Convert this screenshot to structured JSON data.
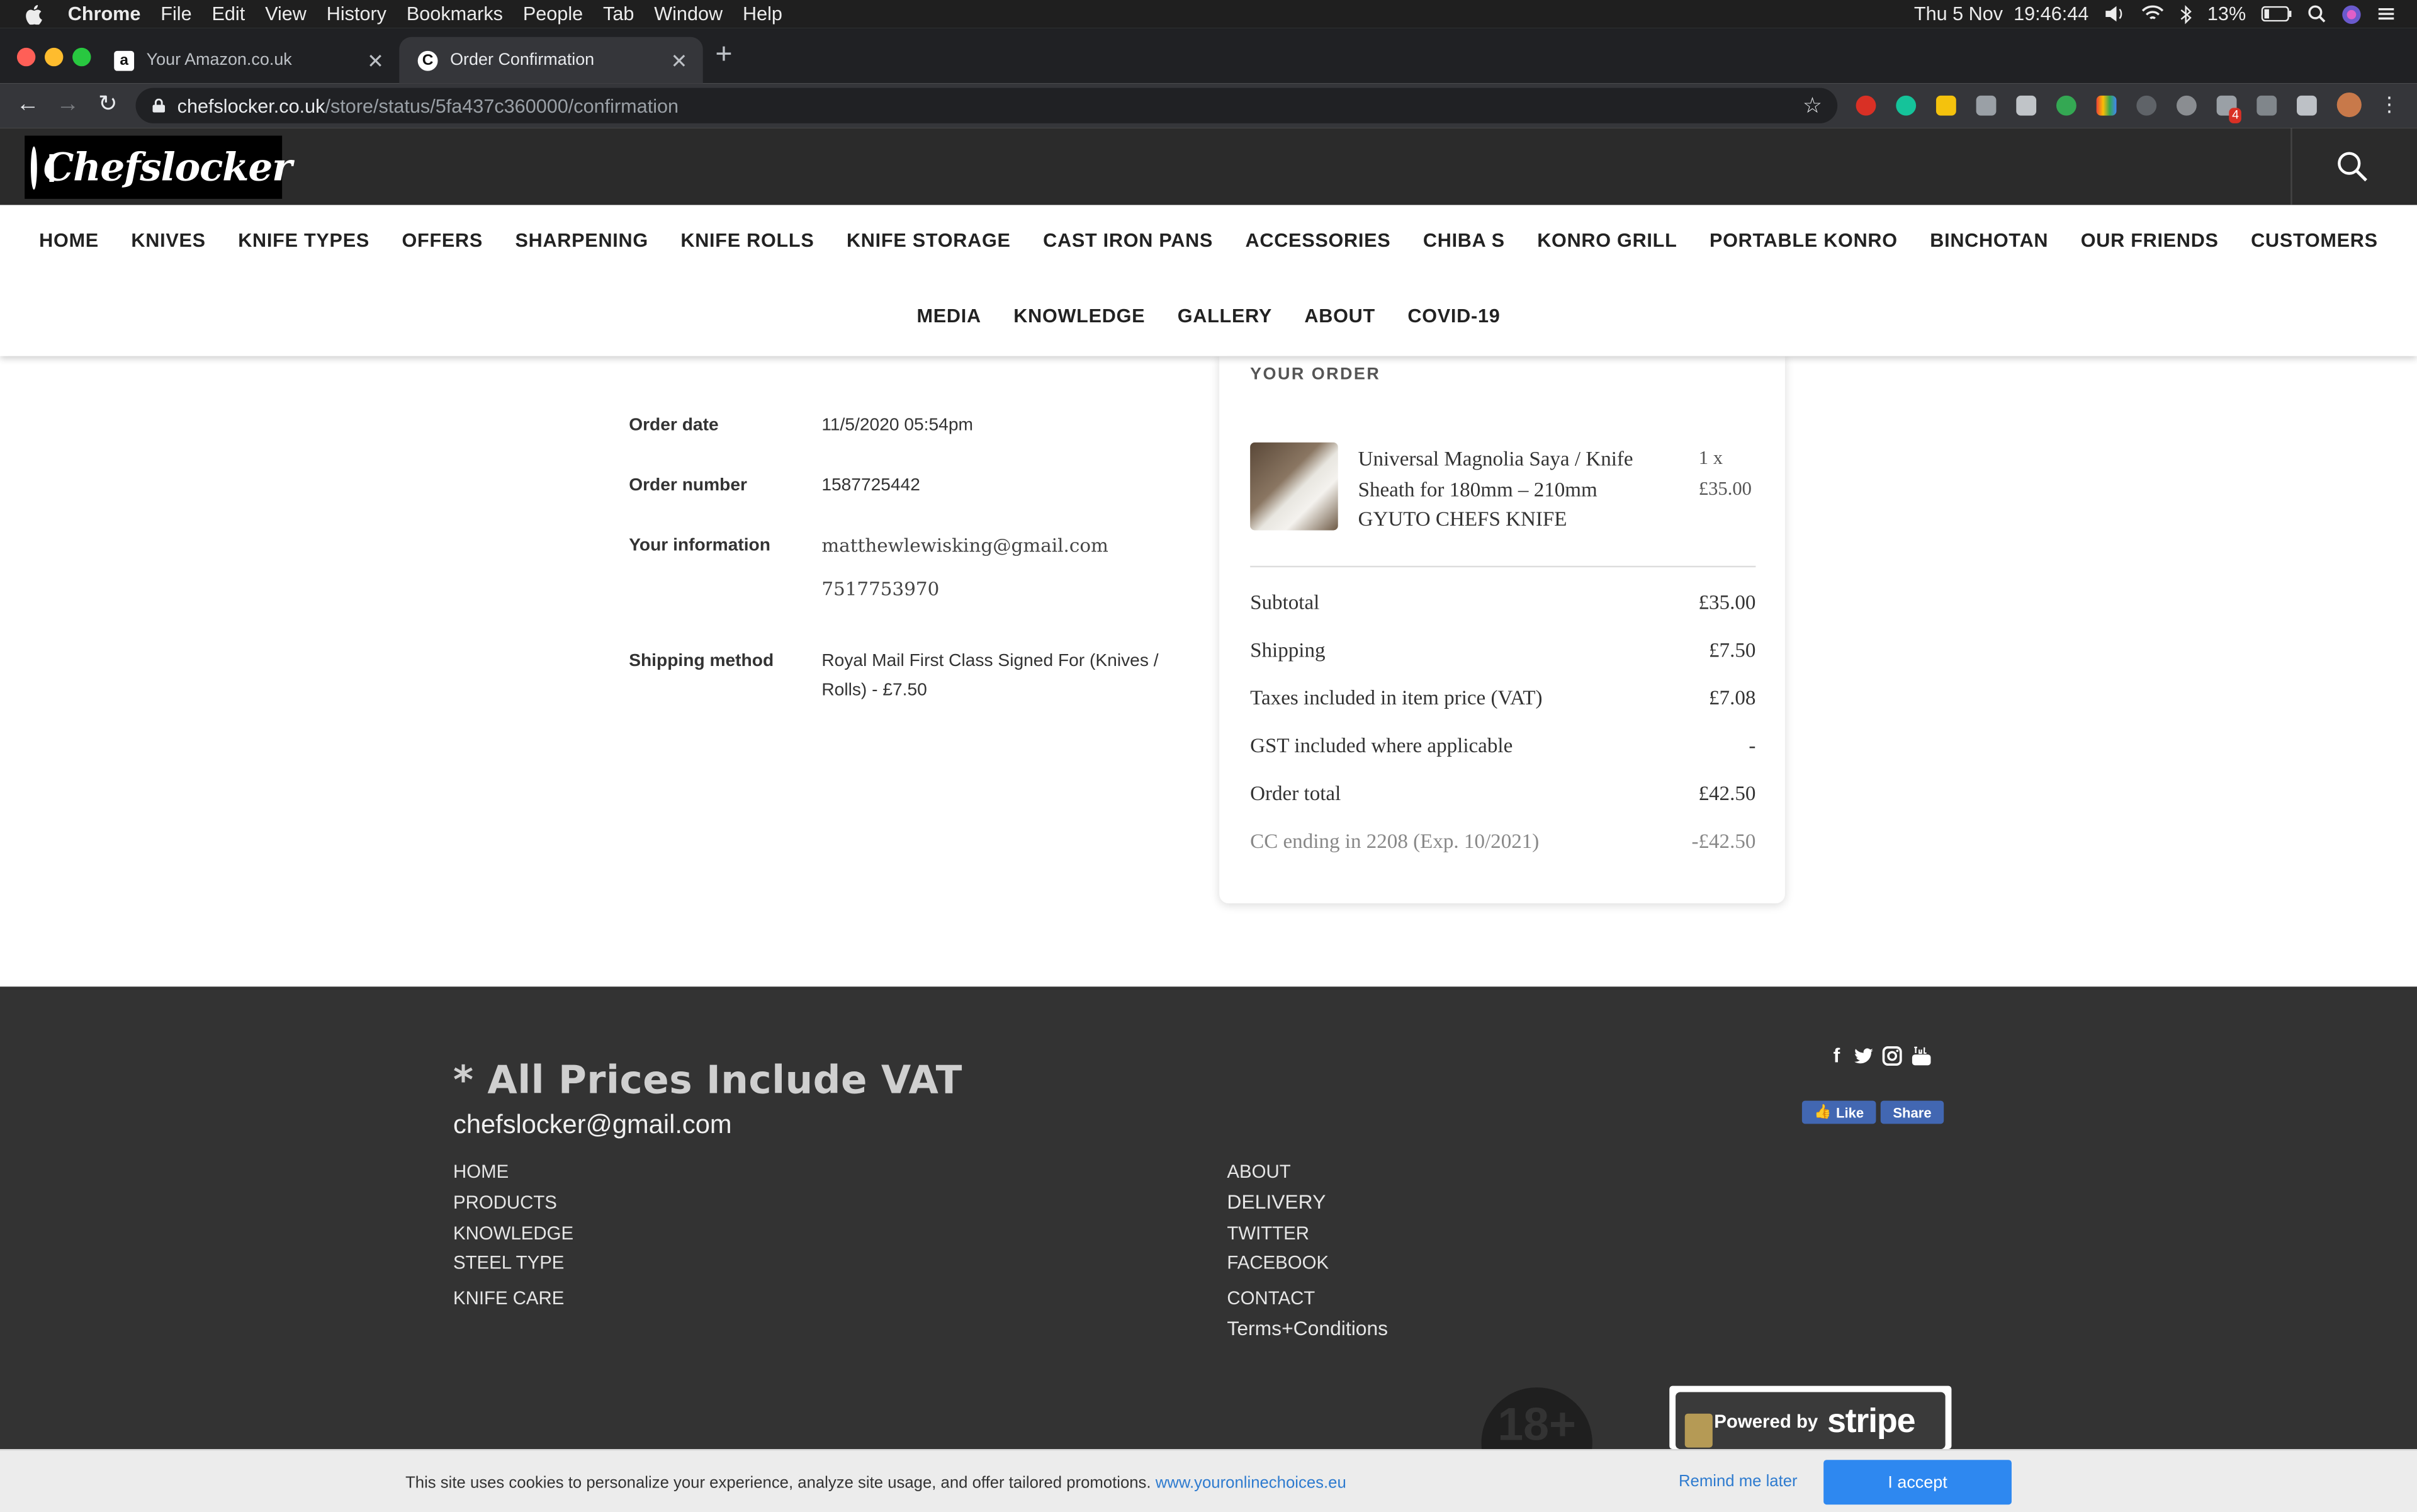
{
  "menubar": {
    "app": "Chrome",
    "items": [
      "File",
      "Edit",
      "View",
      "History",
      "Bookmarks",
      "People",
      "Tab",
      "Window",
      "Help"
    ],
    "clock": "Thu 5 Nov  19:46:44",
    "battery": "13%"
  },
  "tabs": [
    {
      "title": "Your Amazon.co.uk",
      "favicon": "a"
    },
    {
      "title": "Order Confirmation",
      "favicon": "C"
    }
  ],
  "address_bar": {
    "host": "chefslocker.co.uk",
    "path": "/store/status/5fa437c360000/confirmation"
  },
  "extensions": {
    "badge_count": "4"
  },
  "site": {
    "logo_text": "Chefslocker",
    "nav_row1": [
      "HOME",
      "KNIVES",
      "KNIFE TYPES",
      "OFFERS",
      "SHARPENING",
      "KNIFE ROLLS",
      "KNIFE STORAGE",
      "CAST IRON PANS",
      "ACCESSORIES",
      "CHIBA S",
      "KONRO GRILL",
      "PORTABLE KONRO",
      "BINCHOTAN",
      "OUR FRIENDS",
      "CUSTOMERS"
    ],
    "nav_row2": [
      "MEDIA",
      "KNOWLEDGE",
      "GALLERY",
      "ABOUT",
      "COVID-19"
    ]
  },
  "order": {
    "order_date_label": "Order date",
    "order_date": "11/5/2020 05:54pm",
    "order_number_label": "Order number",
    "order_number": "1587725442",
    "your_info_label": "Your information",
    "email": "matthewlewisking@gmail.com",
    "phone": "7517753970",
    "shipping_method_label": "Shipping method",
    "shipping_line1": "Royal Mail First Class Signed For (Knives /",
    "shipping_line2": "Rolls) - £7.50"
  },
  "your_order": {
    "title": "YOUR ORDER",
    "item": {
      "name_line1": "Universal Magnolia Saya / Knife",
      "name_line2": "Sheath for 180mm – 210mm",
      "name_line3": "GYUTO CHEFS KNIFE",
      "qty": "1 x",
      "price": "£35.00"
    },
    "summary": [
      {
        "label": "Subtotal",
        "amount": "£35.00"
      },
      {
        "label": "Shipping",
        "amount": "£7.50"
      },
      {
        "label": "Taxes included in item price (VAT)",
        "amount": "£7.08"
      },
      {
        "label": "GST included where applicable",
        "amount": "-"
      },
      {
        "label": "Order total",
        "amount": "£42.50"
      },
      {
        "label": "CC ending in 2208 (Exp. 10/2021)",
        "amount": "-£42.50"
      }
    ]
  },
  "footer": {
    "vat_note": "* All Prices Include VAT",
    "email": "chefslocker@gmail.com",
    "links_left": [
      "HOME",
      "PRODUCTS",
      "KNOWLEDGE",
      "STEEL TYPE",
      "KNIFE CARE"
    ],
    "links_right": [
      "ABOUT",
      "DELIVERY",
      "TWITTER",
      "FACEBOOK",
      "CONTACT",
      "Terms+Conditions"
    ],
    "fb_like": "Like",
    "fb_share": "Share",
    "age_badge": "18+",
    "stripe_powered": "Powered by",
    "stripe_brand": "stripe"
  },
  "cookie_bar": {
    "text": "This site uses cookies to personalize your experience, analyze site usage, and offer tailored promotions.",
    "link": "www.youronlinechoices.eu",
    "remind": "Remind me later",
    "accept": "I accept"
  },
  "colors": {
    "header_bg": "#2b2b2b",
    "footer_bg": "#333333",
    "accept_button": "#2e88f0",
    "link_blue": "#2e7bcf"
  }
}
